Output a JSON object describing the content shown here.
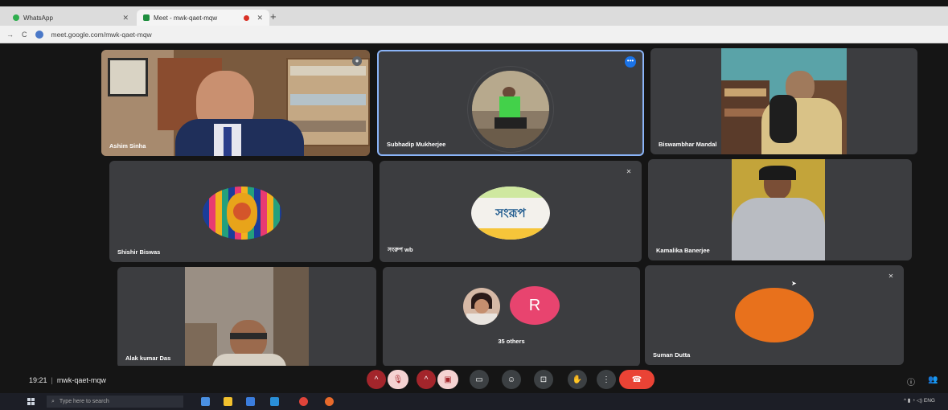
{
  "browser": {
    "tabs": [
      {
        "label": "WhatsApp",
        "close": "✕"
      },
      {
        "label": "Meet - mwk-qaet-mqw",
        "close": "✕"
      }
    ],
    "new_tab": "+",
    "url": "meet.google.com/mwk-qaet-mqw",
    "nav_back": "←",
    "nav_forward": "→",
    "nav_reload": "C"
  },
  "participants": [
    {
      "name": "Ashim Sinha"
    },
    {
      "name": "Subhadip Mukherjee"
    },
    {
      "name": "Biswambhar Mandal"
    },
    {
      "name": "Shishir Biswas"
    },
    {
      "name": "সংরুপ wb"
    },
    {
      "name": "Kamalika Banerjee"
    },
    {
      "name": "Alak kumar Das"
    },
    {
      "name": "35 others",
      "avatar_letter": "R"
    },
    {
      "name": "Suman Dutta"
    }
  ],
  "avatar_logo_text": "সংরূপ",
  "meeting": {
    "time": "19:21",
    "separator": "|",
    "code": "mwk-qaet-mqw"
  },
  "controls": {
    "expand": "^",
    "mic": "🎙",
    "camera": "▣",
    "captions": "▭",
    "emoji": "☺",
    "present": "⊡",
    "hand": "✋",
    "more": "⋮",
    "end": "☎"
  },
  "taskbar": {
    "search_placeholder": "Type here to search",
    "tray_lang": "ENG"
  },
  "colors": {
    "tile_bg": "#3c3d40",
    "active_border": "#8ab4f8",
    "end_call": "#ea4335",
    "avatar_r": "#e8446f",
    "avatar_orange": "#e8711c"
  }
}
